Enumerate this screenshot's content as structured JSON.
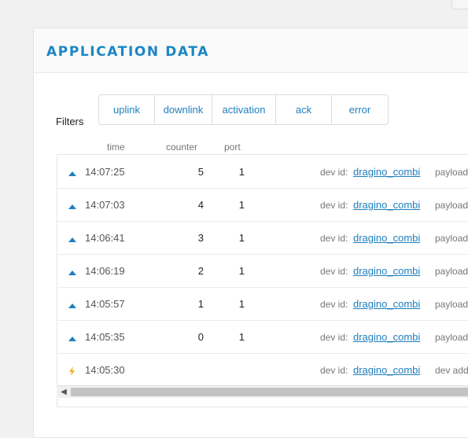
{
  "header": {
    "title": "APPLICATION DATA"
  },
  "filters": {
    "label": "Filters",
    "buttons": [
      {
        "label": "uplink"
      },
      {
        "label": "downlink"
      },
      {
        "label": "activation"
      },
      {
        "label": "ack"
      },
      {
        "label": "error"
      }
    ]
  },
  "columns": {
    "time": "time",
    "counter": "counter",
    "port": "port"
  },
  "rows": [
    {
      "icon": "uplink-arrow-icon",
      "time": "14:07:25",
      "counter": "5",
      "port": "1",
      "dev_label": "dev id:",
      "dev_id": "dragino_combi",
      "extra_label": "payload"
    },
    {
      "icon": "uplink-arrow-icon",
      "time": "14:07:03",
      "counter": "4",
      "port": "1",
      "dev_label": "dev id:",
      "dev_id": "dragino_combi",
      "extra_label": "payload"
    },
    {
      "icon": "uplink-arrow-icon",
      "time": "14:06:41",
      "counter": "3",
      "port": "1",
      "dev_label": "dev id:",
      "dev_id": "dragino_combi",
      "extra_label": "payload"
    },
    {
      "icon": "uplink-arrow-icon",
      "time": "14:06:19",
      "counter": "2",
      "port": "1",
      "dev_label": "dev id:",
      "dev_id": "dragino_combi",
      "extra_label": "payload"
    },
    {
      "icon": "uplink-arrow-icon",
      "time": "14:05:57",
      "counter": "1",
      "port": "1",
      "dev_label": "dev id:",
      "dev_id": "dragino_combi",
      "extra_label": "payload"
    },
    {
      "icon": "uplink-arrow-icon",
      "time": "14:05:35",
      "counter": "0",
      "port": "1",
      "dev_label": "dev id:",
      "dev_id": "dragino_combi",
      "extra_label": "payload"
    },
    {
      "icon": "activation-bolt-icon",
      "time": "14:05:30",
      "counter": "",
      "port": "",
      "dev_label": "dev id:",
      "dev_id": "dragino_combi",
      "extra_label": "dev addr"
    }
  ],
  "colors": {
    "accent": "#1b86c4",
    "link": "#1f7fbe",
    "activation": "#f0b323"
  },
  "scroll": {
    "left_arrow": "◀"
  }
}
